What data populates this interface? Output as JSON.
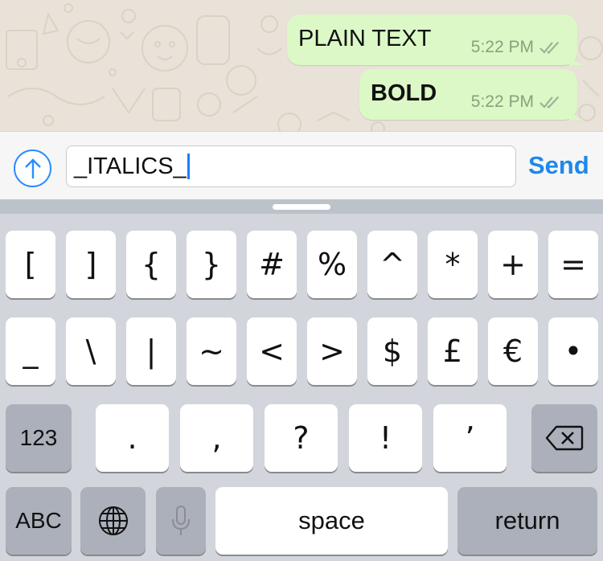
{
  "messages": [
    {
      "text": "PLAIN TEXT",
      "time": "5:22 PM",
      "status_icon": "double-check-icon"
    },
    {
      "text": "BOLD",
      "time": "5:22 PM",
      "status_icon": "double-check-icon"
    }
  ],
  "composer": {
    "attach_icon": "arrow-up-circle-icon",
    "value": "_ITALICS_",
    "send_label": "Send",
    "accent": "#1e88ec"
  },
  "keyboard": {
    "row1": [
      "[",
      "]",
      "{",
      "}",
      "#",
      "%",
      "^",
      "*",
      "+",
      "="
    ],
    "row2": [
      "_",
      "\\",
      "|",
      "~",
      "<",
      ">",
      "$",
      "£",
      "€",
      "•"
    ],
    "row3": {
      "mode_label": "123",
      "keys": [
        ".",
        ",",
        "?",
        "!",
        "’"
      ],
      "delete_icon": "backspace-icon"
    },
    "row4": {
      "abc_label": "ABC",
      "globe_icon": "globe-icon",
      "mic_icon": "microphone-icon",
      "space_label": "space",
      "return_label": "return"
    }
  },
  "colors": {
    "bubble": "#dcf8c6",
    "chat_bg": "#e8e2d8",
    "keyboard_bg": "#d2d5db"
  }
}
